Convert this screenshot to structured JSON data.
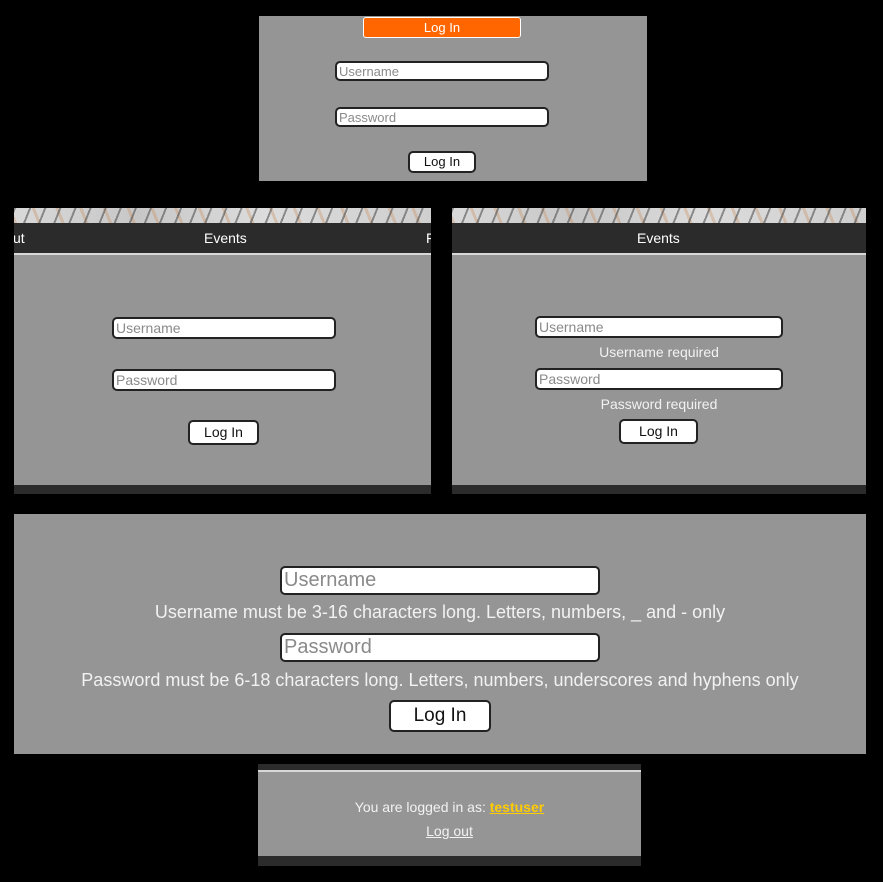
{
  "panel1": {
    "title": "Log In",
    "username_placeholder": "Username",
    "password_placeholder": "Password",
    "login_label": "Log In"
  },
  "panel2": {
    "nav_left": "ut",
    "nav_center": "Events",
    "nav_right": "F",
    "username_placeholder": "Username",
    "password_placeholder": "Password",
    "login_label": "Log In"
  },
  "panel3": {
    "nav_center": "Events",
    "username_placeholder": "Username",
    "username_error": "Username required",
    "password_placeholder": "Password",
    "password_error": "Password required",
    "login_label": "Log In"
  },
  "panel4": {
    "username_placeholder": "Username",
    "username_hint": "Username must be 3-16 characters long. Letters, numbers, _ and - only",
    "password_placeholder": "Password",
    "password_hint": "Password must be 6-18 characters long. Letters, numbers, underscores and hyphens only",
    "login_label": "Log In"
  },
  "panel5": {
    "logged_in_text": "You are logged in as:",
    "username": "testuser",
    "logout_label": "Log out"
  },
  "colors": {
    "background": "#000000",
    "panel": "#959595",
    "accent": "#ff6600",
    "username_link": "#ffcc00",
    "navbar": "#2b2b2b"
  }
}
